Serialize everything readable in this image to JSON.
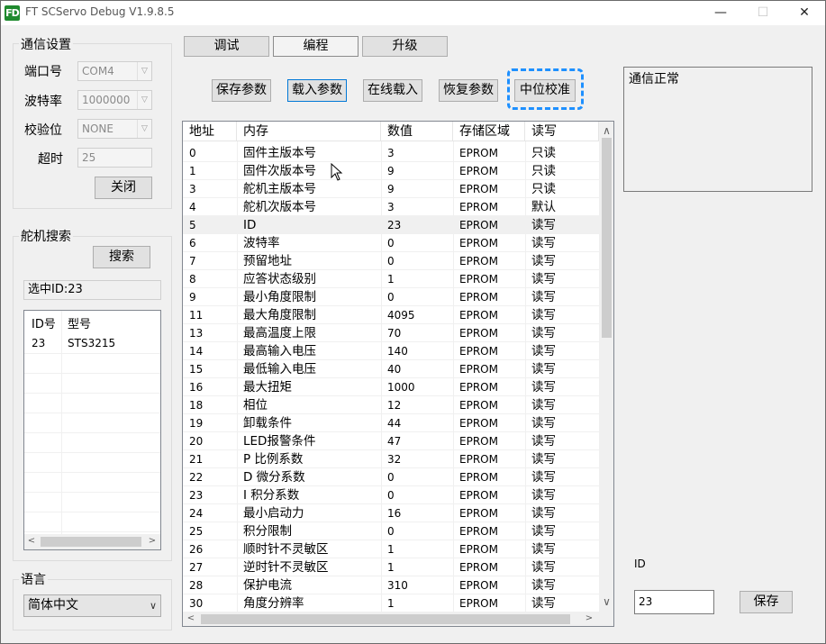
{
  "window": {
    "title": "FT SCServo Debug V1.9.8.5",
    "icon_text": "FD",
    "minimize": "—",
    "maximize": "☐",
    "close": "✕"
  },
  "comm": {
    "group_title": "通信设置",
    "port_label": "端口号",
    "port_value": "COM4",
    "baud_label": "波特率",
    "baud_value": "1000000",
    "parity_label": "校验位",
    "parity_value": "NONE",
    "timeout_label": "超时",
    "timeout_value": "25",
    "close_button": "关闭"
  },
  "search": {
    "group_title": "舵机搜索",
    "search_button": "搜索",
    "selected_text": "选中ID:23",
    "list_headers": [
      "ID号",
      "型号"
    ],
    "list_rows": [
      {
        "id": "23",
        "model": "STS3215"
      }
    ]
  },
  "language": {
    "group_title": "语言",
    "value": "简体中文"
  },
  "tabs": [
    "调试",
    "编程",
    "升级"
  ],
  "active_tab": "编程",
  "toolbar": {
    "save_params": "保存参数",
    "load_params": "载入参数",
    "online_load": "在线载入",
    "restore_params": "恢复参数",
    "center_calib": "中位校准"
  },
  "table": {
    "headers": [
      "地址",
      "内存",
      "数值",
      "存储区域",
      "读写"
    ],
    "rows": [
      {
        "addr": "0",
        "mem": "固件主版本号",
        "val": "3",
        "area": "EPROM",
        "rw": "只读"
      },
      {
        "addr": "1",
        "mem": "固件次版本号",
        "val": "9",
        "area": "EPROM",
        "rw": "只读"
      },
      {
        "addr": "3",
        "mem": "舵机主版本号",
        "val": "9",
        "area": "EPROM",
        "rw": "只读"
      },
      {
        "addr": "4",
        "mem": "舵机次版本号",
        "val": "3",
        "area": "EPROM",
        "rw": "默认"
      },
      {
        "addr": "5",
        "mem": "ID",
        "val": "23",
        "area": "EPROM",
        "rw": "读写"
      },
      {
        "addr": "6",
        "mem": "波特率",
        "val": "0",
        "area": "EPROM",
        "rw": "读写"
      },
      {
        "addr": "7",
        "mem": "预留地址",
        "val": "0",
        "area": "EPROM",
        "rw": "读写"
      },
      {
        "addr": "8",
        "mem": "应答状态级别",
        "val": "1",
        "area": "EPROM",
        "rw": "读写"
      },
      {
        "addr": "9",
        "mem": "最小角度限制",
        "val": "0",
        "area": "EPROM",
        "rw": "读写"
      },
      {
        "addr": "11",
        "mem": "最大角度限制",
        "val": "4095",
        "area": "EPROM",
        "rw": "读写"
      },
      {
        "addr": "13",
        "mem": "最高温度上限",
        "val": "70",
        "area": "EPROM",
        "rw": "读写"
      },
      {
        "addr": "14",
        "mem": "最高输入电压",
        "val": "140",
        "area": "EPROM",
        "rw": "读写"
      },
      {
        "addr": "15",
        "mem": "最低输入电压",
        "val": "40",
        "area": "EPROM",
        "rw": "读写"
      },
      {
        "addr": "16",
        "mem": "最大扭矩",
        "val": "1000",
        "area": "EPROM",
        "rw": "读写"
      },
      {
        "addr": "18",
        "mem": "相位",
        "val": "12",
        "area": "EPROM",
        "rw": "读写"
      },
      {
        "addr": "19",
        "mem": "卸载条件",
        "val": "44",
        "area": "EPROM",
        "rw": "读写"
      },
      {
        "addr": "20",
        "mem": "LED报警条件",
        "val": "47",
        "area": "EPROM",
        "rw": "读写"
      },
      {
        "addr": "21",
        "mem": "P 比例系数",
        "val": "32",
        "area": "EPROM",
        "rw": "读写"
      },
      {
        "addr": "22",
        "mem": "D 微分系数",
        "val": "0",
        "area": "EPROM",
        "rw": "读写"
      },
      {
        "addr": "23",
        "mem": "I 积分系数",
        "val": "0",
        "area": "EPROM",
        "rw": "读写"
      },
      {
        "addr": "24",
        "mem": "最小启动力",
        "val": "16",
        "area": "EPROM",
        "rw": "读写"
      },
      {
        "addr": "25",
        "mem": "积分限制",
        "val": "0",
        "area": "EPROM",
        "rw": "读写"
      },
      {
        "addr": "26",
        "mem": "顺时针不灵敏区",
        "val": "1",
        "area": "EPROM",
        "rw": "读写"
      },
      {
        "addr": "27",
        "mem": "逆时针不灵敏区",
        "val": "1",
        "area": "EPROM",
        "rw": "读写"
      },
      {
        "addr": "28",
        "mem": "保护电流",
        "val": "310",
        "area": "EPROM",
        "rw": "读写"
      },
      {
        "addr": "30",
        "mem": "角度分辨率",
        "val": "1",
        "area": "EPROM",
        "rw": "读写"
      }
    ],
    "selected_row": 4
  },
  "status": {
    "text": "通信正常"
  },
  "id_edit": {
    "label": "ID",
    "value": "23",
    "save_button": "保存"
  },
  "icons": {
    "dropdown": "chevron-down-icon",
    "scroll_up": "▲",
    "scroll_down": "▼",
    "scroll_left": "◀",
    "scroll_right": "▶"
  },
  "colors": {
    "accent": "#0078d7",
    "highlight_dash": "#1e90ff",
    "selected_row_bg": "#f0f0f0"
  }
}
